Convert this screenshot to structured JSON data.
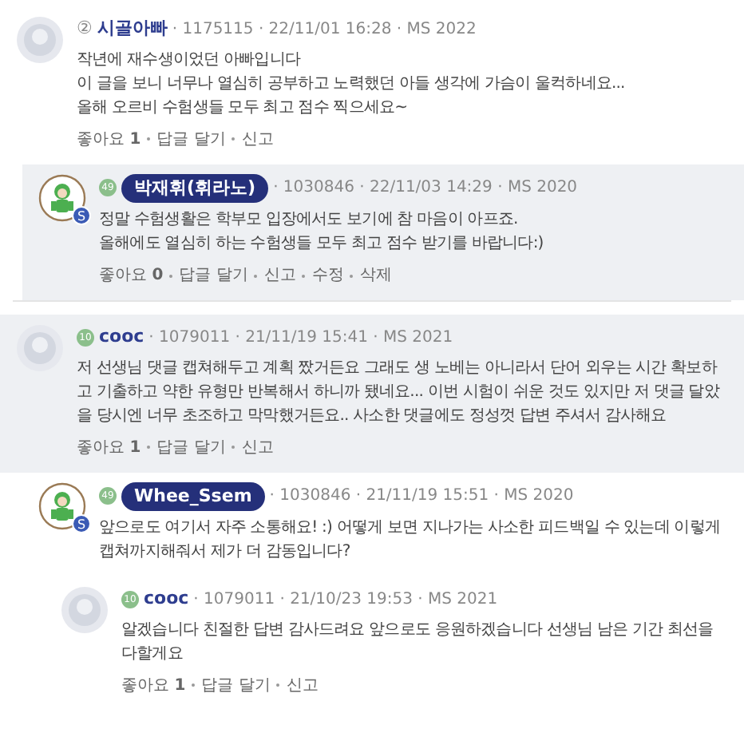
{
  "comments": [
    {
      "avatar": {
        "kind": "plain"
      },
      "level": {
        "kind": "circled",
        "text": "②"
      },
      "nickname": "시골아빠",
      "author": false,
      "highlighted": false,
      "meta": "· 1175115 · 22/11/01 16:28 · MS 2022",
      "body": [
        "작년에 재수생이었던 아빠입니다",
        "이 글을 보니 너무나 열심히 공부하고 노력했던 아들 생각에 가슴이 울컥하네요...",
        "올해 오르비 수험생들 모두 최고 점수 찍으세요~"
      ],
      "like": {
        "label": "좋아요",
        "count": "1"
      },
      "actions": [
        "답글 달기",
        "신고"
      ],
      "children": [
        {
          "avatar": {
            "kind": "character",
            "badge": "S"
          },
          "level": {
            "kind": "green",
            "text": "49"
          },
          "nickname": "박재휘(휘라노)",
          "author": true,
          "highlighted": true,
          "meta": "· 1030846 · 22/11/03 14:29 · MS 2020",
          "body": [
            "정말 수험생활은 학부모 입장에서도 보기에 참 마음이 아프죠.",
            "올해에도 열심히 하는 수험생들 모두 최고 점수 받기를 바랍니다:)"
          ],
          "like": {
            "label": "좋아요",
            "count": "0"
          },
          "actions": [
            "답글 달기",
            "신고",
            "수정",
            "삭제"
          ]
        }
      ]
    },
    {
      "avatar": {
        "kind": "plain"
      },
      "level": {
        "kind": "green",
        "text": "10"
      },
      "nickname": "cooc",
      "author": false,
      "highlighted": true,
      "meta": "· 1079011 · 21/11/19 15:41 · MS 2021",
      "body": [
        "저 선생님 댓글 캡쳐해두고 계획 짰거든요 그래도 생 노베는 아니라서 단어 외우는 시간 확보하고 기출하고 약한 유형만 반복해서 하니까 됐네요... 이번 시험이 쉬운 것도 있지만 저 댓글 달았을 당시엔 너무 초조하고 막막했거든요.. 사소한 댓글에도 정성껏 답변 주셔서 감사해요"
      ],
      "like": {
        "label": "좋아요",
        "count": "1"
      },
      "actions": [
        "답글 달기",
        "신고"
      ],
      "children": [
        {
          "avatar": {
            "kind": "character",
            "badge": "S"
          },
          "level": {
            "kind": "green",
            "text": "49"
          },
          "nickname": "Whee_Ssem",
          "author": true,
          "highlighted": false,
          "meta": "· 1030846 · 21/11/19 15:51 · MS 2020",
          "body": [
            "앞으로도 여기서 자주 소통해요! :) 어떻게 보면 지나가는 사소한 피드백일 수 있는데 이렇게 캡쳐까지해줘서 제가 더 감동입니다?"
          ],
          "children": [
            {
              "avatar": {
                "kind": "plain"
              },
              "level": {
                "kind": "green",
                "text": "10"
              },
              "nickname": "cooc",
              "author": false,
              "highlighted": false,
              "meta": "· 1079011 · 21/10/23 19:53 · MS 2021",
              "body": [
                "알겠습니다 친절한 답변 감사드려요 앞으로도 응원하겠습니다 선생님 남은 기간 최선을 다할게요"
              ],
              "like": {
                "label": "좋아요",
                "count": "1"
              },
              "actions": [
                "답글 달기",
                "신고"
              ]
            }
          ]
        }
      ]
    }
  ]
}
